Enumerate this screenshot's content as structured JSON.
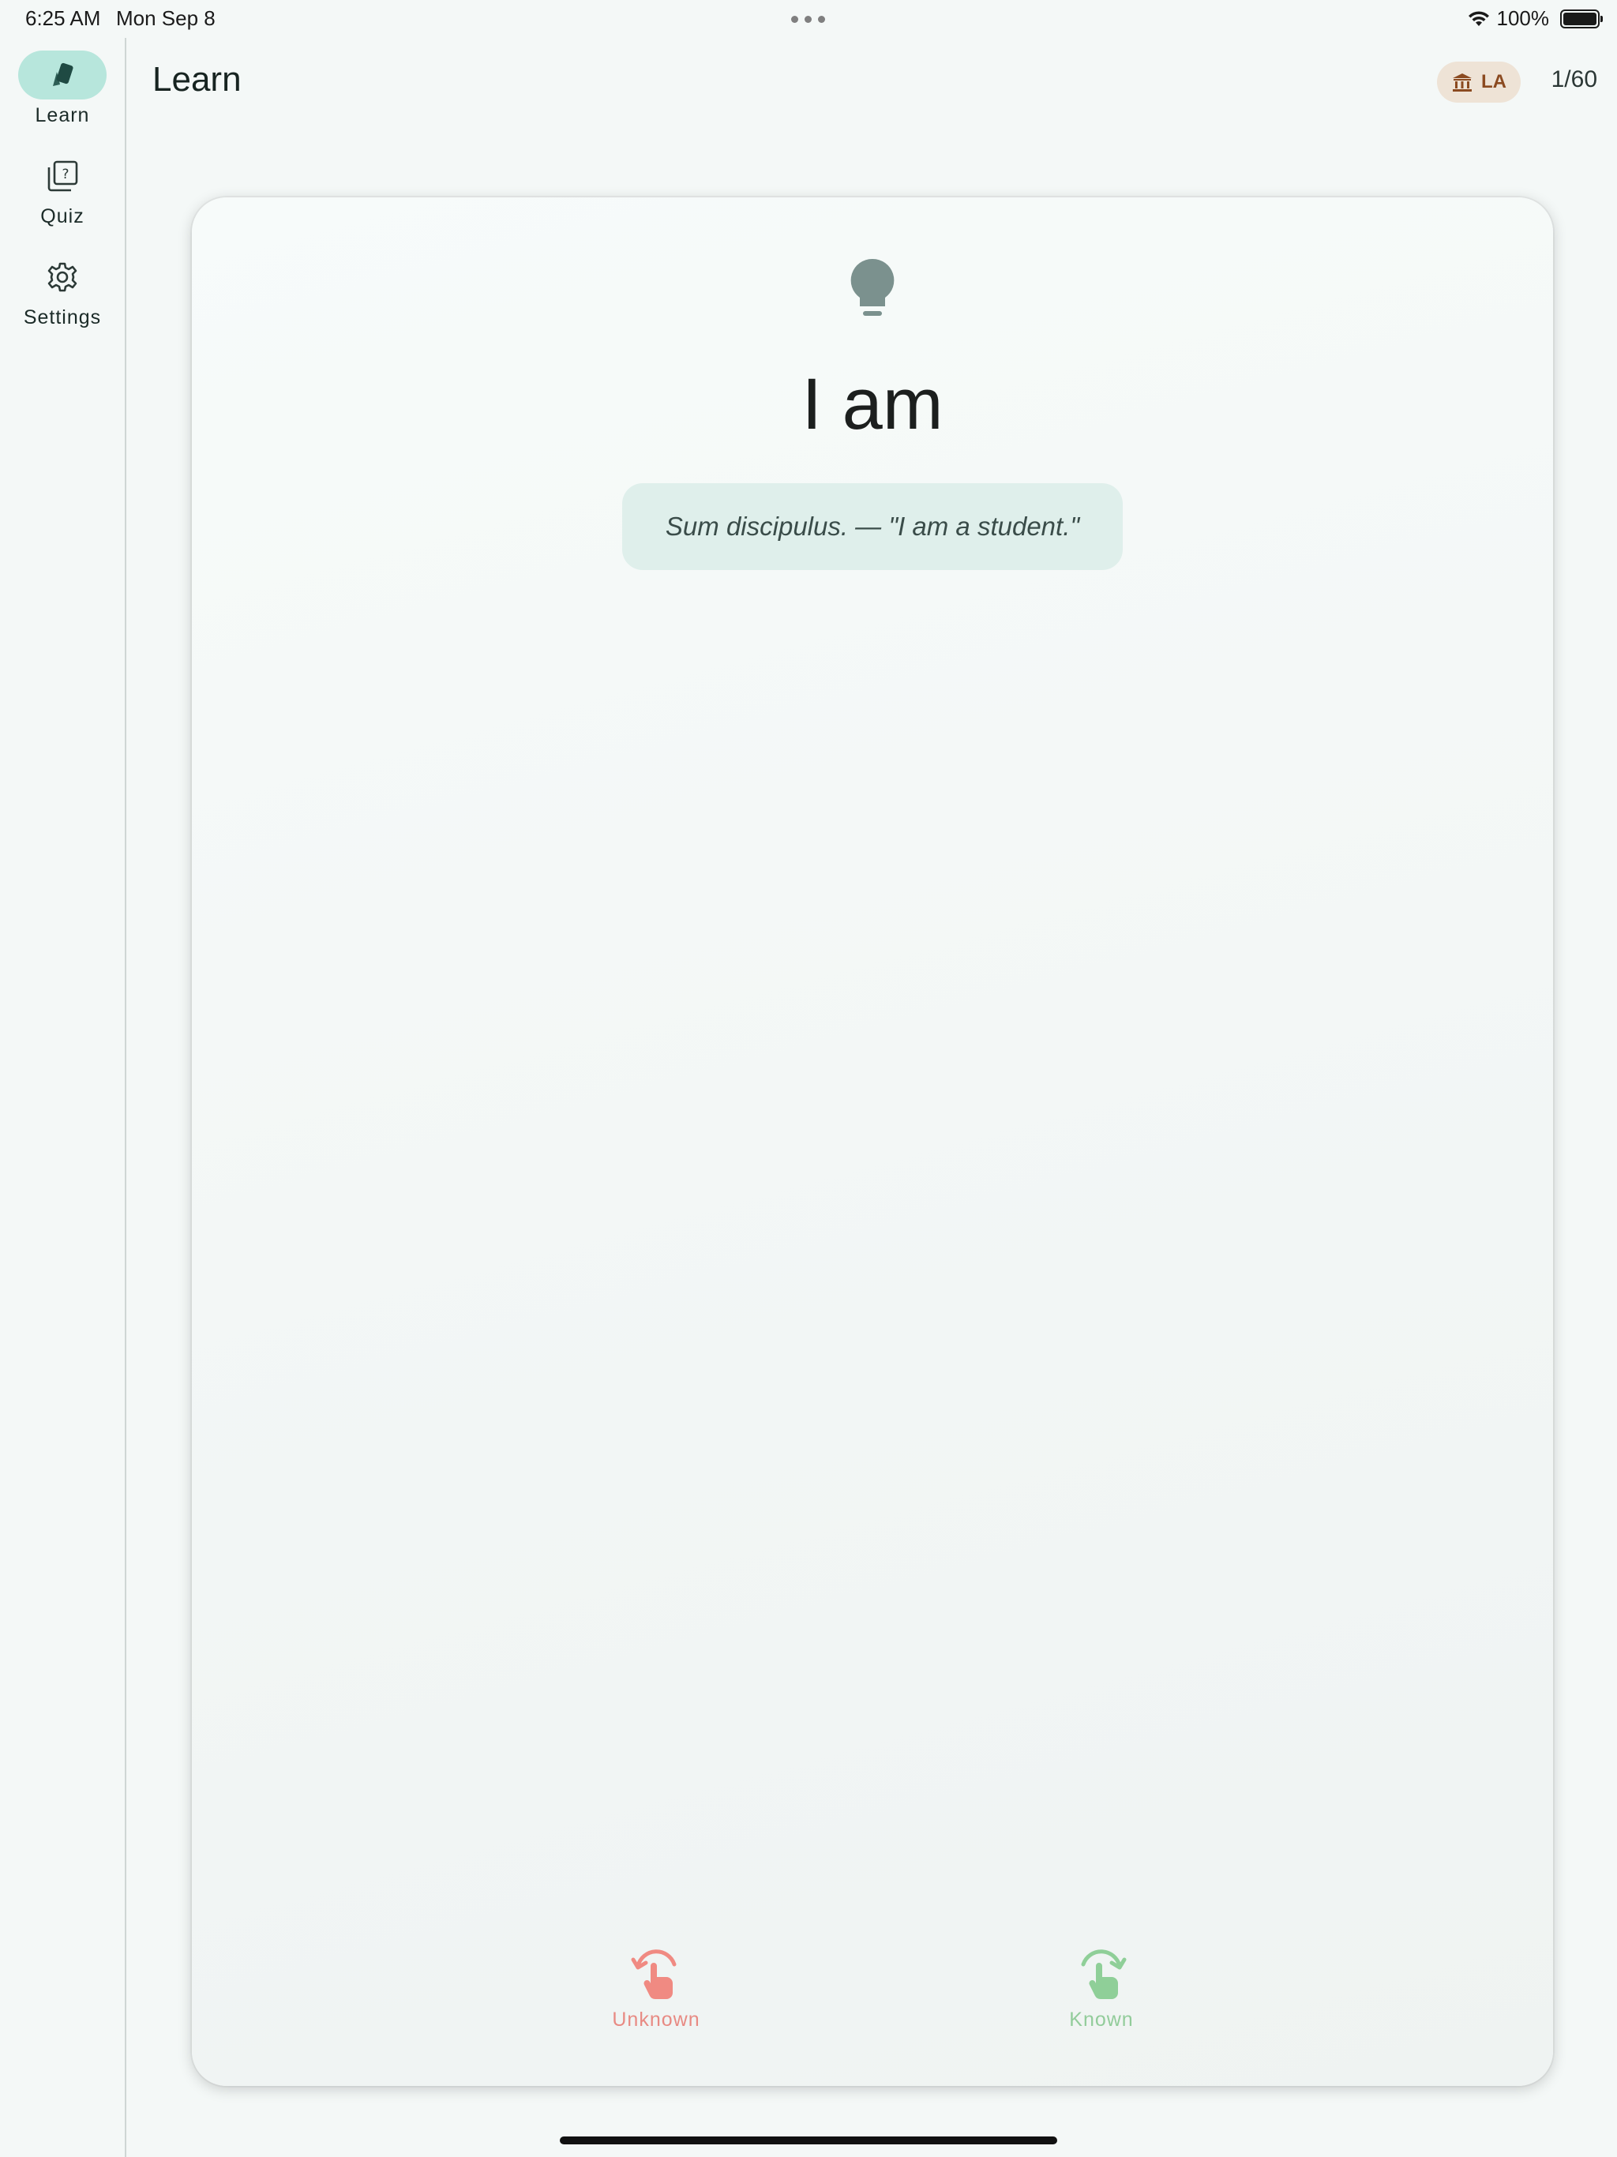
{
  "status_bar": {
    "time": "6:25 AM",
    "date": "Mon Sep 8",
    "battery": "100%"
  },
  "sidebar": {
    "items": [
      {
        "label": "Learn",
        "icon": "cards-icon",
        "active": true
      },
      {
        "label": "Quiz",
        "icon": "quiz-icon",
        "active": false
      },
      {
        "label": "Settings",
        "icon": "gear-icon",
        "active": false
      }
    ]
  },
  "header": {
    "title": "Learn",
    "language_badge": "LA",
    "progress": "1/60"
  },
  "card": {
    "icon": "lightbulb-icon",
    "word": "I am",
    "example": "Sum discipulus. — \"I am a student.\"",
    "actions": {
      "unknown_label": "Unknown",
      "known_label": "Known"
    }
  },
  "colors": {
    "accent": "#b7e6dc",
    "background": "#f4f8f7",
    "unknown": "#f08a82",
    "known": "#8fcf98",
    "badge_bg": "#eee3d6",
    "badge_text": "#8b4a20"
  }
}
